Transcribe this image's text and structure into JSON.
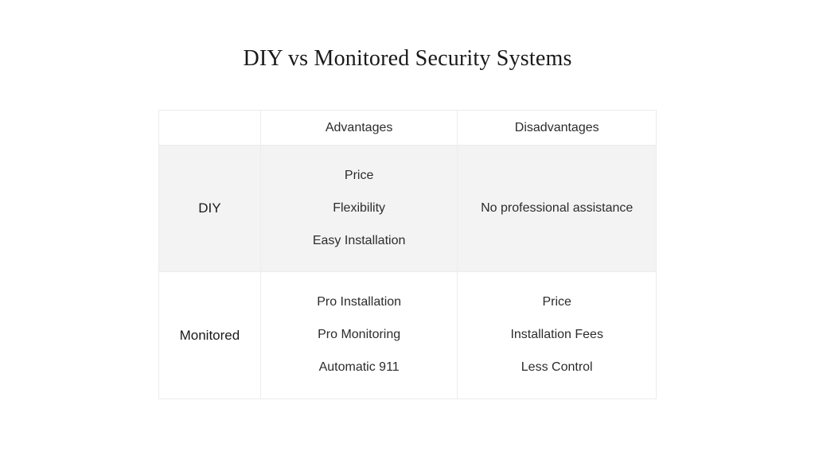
{
  "title": "DIY vs Monitored Security Systems",
  "columns": {
    "empty": "",
    "advantages": "Advantages",
    "disadvantages": "Disadvantages"
  },
  "rows": {
    "diy": {
      "label": "DIY",
      "advantages": [
        "Price",
        "Flexibility",
        "Easy Installation"
      ],
      "disadvantages": [
        "No professional assistance"
      ]
    },
    "monitored": {
      "label": "Monitored",
      "advantages": [
        "Pro Installation",
        "Pro Monitoring",
        "Automatic 911"
      ],
      "disadvantages": [
        "Price",
        "Installation Fees",
        "Less Control"
      ]
    }
  }
}
